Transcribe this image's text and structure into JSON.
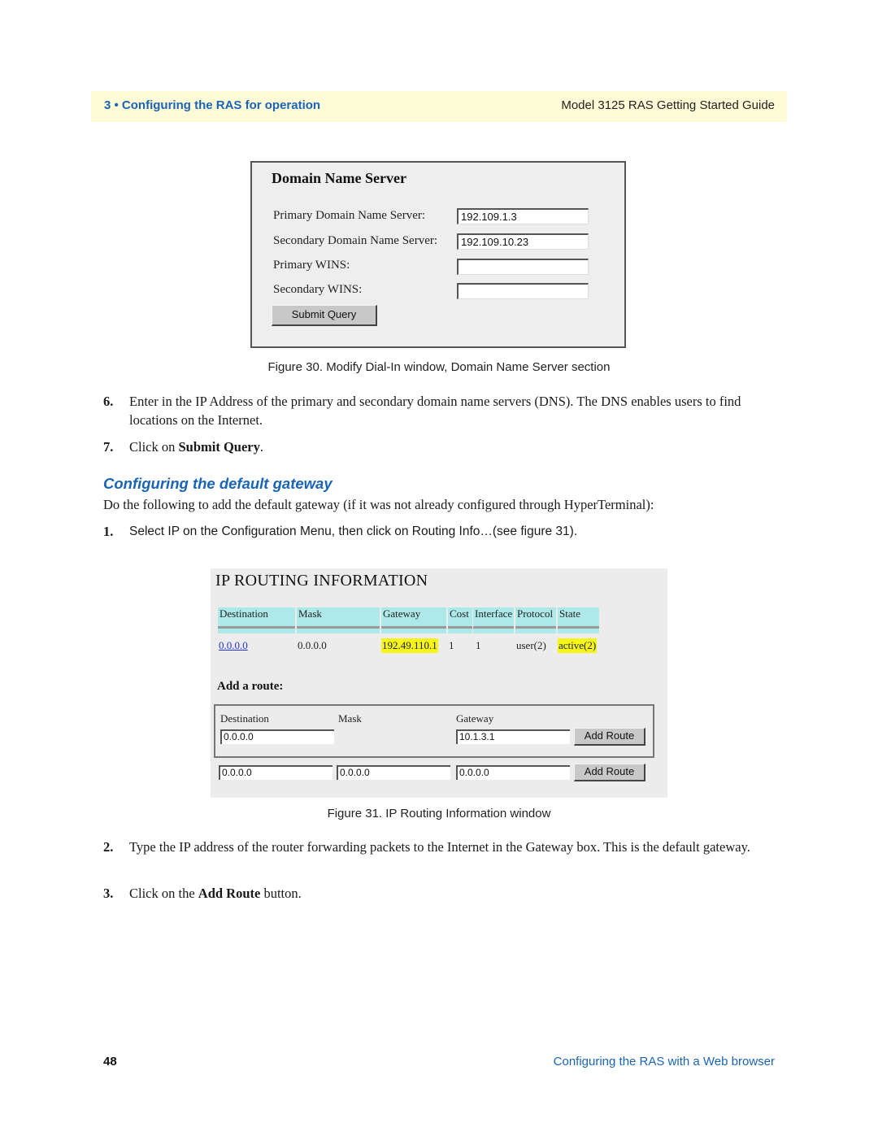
{
  "header": {
    "chapter": "3 • Configuring the RAS for operation",
    "guide_title": "Model 3125 RAS Getting Started Guide"
  },
  "figure30": {
    "title": "Domain Name Server",
    "fields": [
      {
        "label": "Primary Domain Name Server:",
        "value": "192.109.1.3"
      },
      {
        "label": "Secondary Domain Name Server:",
        "value": "192.109.10.23"
      },
      {
        "label": "Primary WINS:",
        "value": ""
      },
      {
        "label": "Secondary WINS:",
        "value": ""
      }
    ],
    "submit_label": "Submit Query",
    "caption": "Figure 30. Modify Dial-In window, Domain Name Server section"
  },
  "steps_a": [
    {
      "num": "6.",
      "text": "Enter in the IP Address of the primary and secondary domain name servers (DNS). The DNS enables users to find locations on the Internet."
    },
    {
      "num": "7.",
      "text_before": "Click on ",
      "bold": "Submit Query",
      "text_after": "."
    }
  ],
  "section": {
    "title": "Configuring the default gateway",
    "intro": "Do the following to add the default gateway (if it was not already configured through HyperTerminal):",
    "step1_num": "1.",
    "step1_text": "Select IP on the Configuration Menu, then click on Routing Info…(see figure 31)."
  },
  "figure31": {
    "title": "IP ROUTING INFORMATION",
    "columns": [
      "Destination",
      "Mask",
      "Gateway",
      "Cost",
      "Interface",
      "Protocol",
      "State"
    ],
    "rows": [
      {
        "destination": "0.0.0.0",
        "mask": "0.0.0.0",
        "gateway": "192.49.110.1",
        "cost": "1",
        "interface": "1",
        "protocol": "user(2)",
        "state": "active(2)"
      }
    ],
    "add_route_title": "Add a route:",
    "add_labels": {
      "destination": "Destination",
      "mask": "Mask",
      "gateway": "Gateway"
    },
    "route1": {
      "destination": "0.0.0.0",
      "gateway": "10.1.3.1"
    },
    "route2": {
      "destination": "0.0.0.0",
      "mask": "0.0.0.0",
      "gateway": "0.0.0.0"
    },
    "add_button_label": "Add Route",
    "caption": "Figure 31. IP Routing Information window"
  },
  "steps_b": [
    {
      "num": "2.",
      "text": "Type the IP address of the router forwarding packets to the Internet in the Gateway box. This is the default gateway."
    },
    {
      "num": "3.",
      "text_before": "Click on the ",
      "bold": "Add Route",
      "text_after": " button."
    }
  ],
  "footer": {
    "page_number": "48",
    "section_title": "Configuring the RAS with a Web browser"
  },
  "colors": {
    "accent_blue": "#1a64b8",
    "header_band": "#fdfcd6",
    "table_header": "#aee9e9",
    "highlight": "#f5f51a"
  }
}
